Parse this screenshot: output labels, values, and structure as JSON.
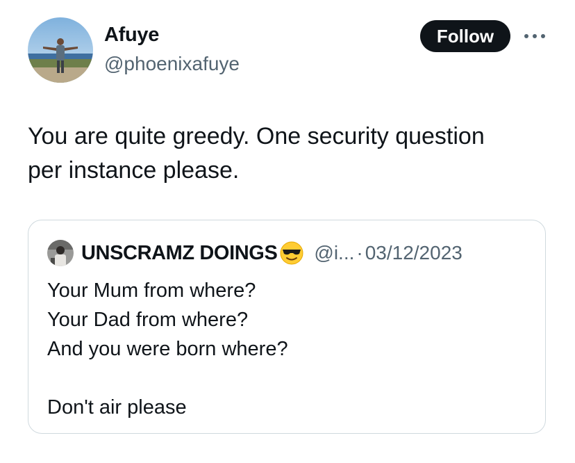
{
  "author": {
    "display_name": "Afuye",
    "handle": "@phoenixafuye",
    "avatar_icon": "user-avatar-photo"
  },
  "actions": {
    "follow_label": "Follow",
    "more_icon": "more-horizontal-icon"
  },
  "tweet": {
    "text": "You are quite greedy. One security question\nper instance please."
  },
  "quoted_tweet": {
    "display_name": "UNSCRAMZ DOINGS",
    "emoji": "smiling-face-with-sunglasses",
    "handle": "@i...",
    "separator": "·",
    "date": "03/12/2023",
    "text": "Your Mum from where?\nYour Dad from where?\nAnd you were born where?\n\nDon't air please"
  },
  "colors": {
    "text_primary": "#0f1419",
    "text_secondary": "#536471",
    "button_bg": "#0f1419",
    "border": "#cfd9de"
  }
}
